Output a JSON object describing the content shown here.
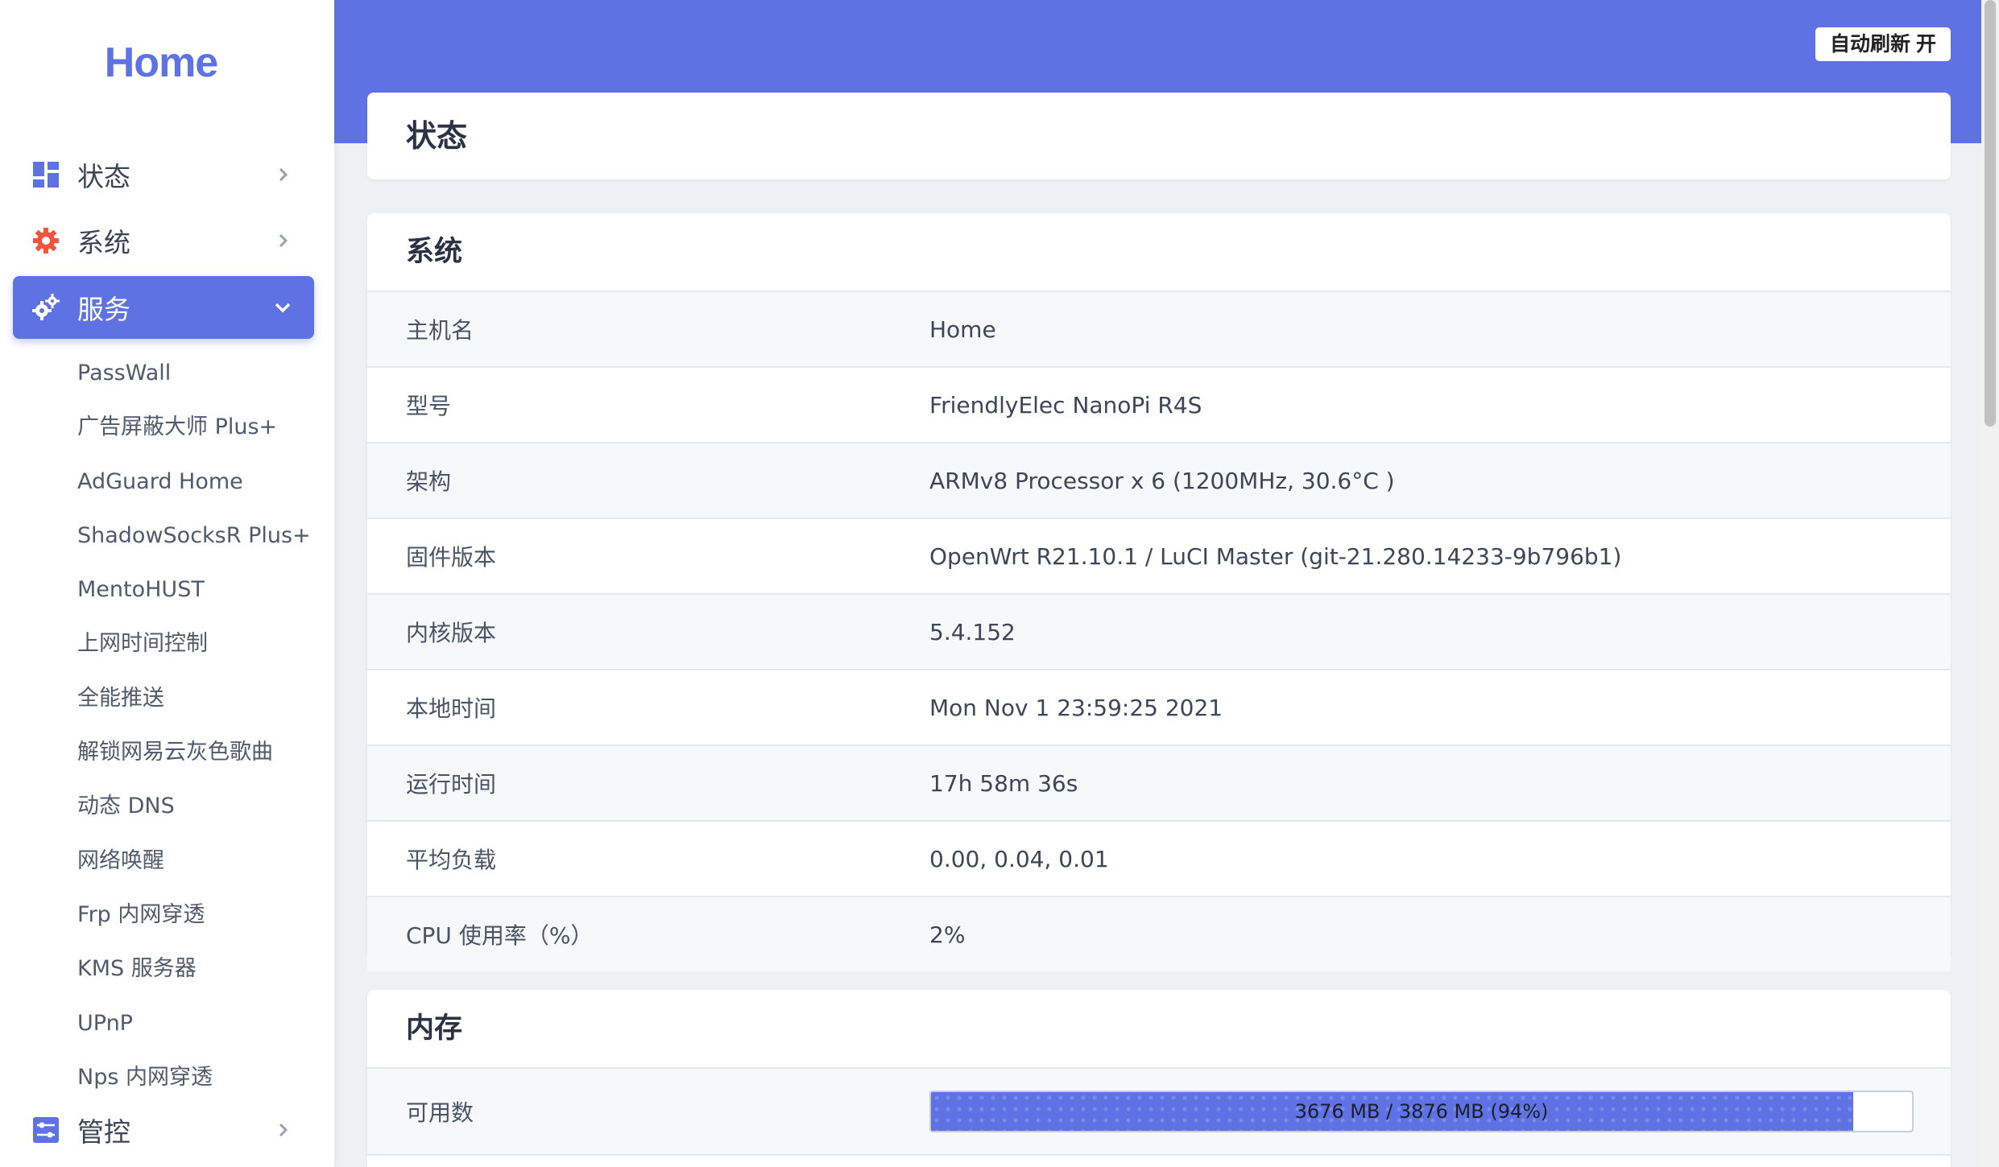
{
  "brand": "Home",
  "header": {
    "auto_refresh_label": "自动刷新 开"
  },
  "nav": {
    "status": {
      "label": "状态",
      "icon": "dashboard-icon",
      "color": "#5e72e4"
    },
    "system": {
      "label": "系统",
      "icon": "gear-icon",
      "color": "#f5533d"
    },
    "services": {
      "label": "服务",
      "icon": "cogs-icon",
      "color": "#ffffff"
    },
    "control": {
      "label": "管控",
      "icon": "sliders-icon",
      "color": "#5e72e4"
    }
  },
  "services_sub": [
    "PassWall",
    "广告屏蔽大师 Plus+",
    "AdGuard Home",
    "ShadowSocksR Plus+",
    "MentoHUST",
    "上网时间控制",
    "全能推送",
    "解锁网易云灰色歌曲",
    "动态 DNS",
    "网络唤醒",
    "Frp 内网穿透",
    "KMS 服务器",
    "UPnP",
    "Nps 内网穿透"
  ],
  "page": {
    "title": "状态"
  },
  "system": {
    "title": "系统",
    "rows": [
      {
        "key": "主机名",
        "value": "Home"
      },
      {
        "key": "型号",
        "value": "FriendlyElec NanoPi R4S"
      },
      {
        "key": "架构",
        "value": "ARMv8 Processor x 6 (1200MHz, 30.6°C )"
      },
      {
        "key": "固件版本",
        "value": "OpenWrt R21.10.1 / LuCI Master (git-21.280.14233-9b796b1)"
      },
      {
        "key": "内核版本",
        "value": "5.4.152"
      },
      {
        "key": "本地时间",
        "value": "Mon Nov 1 23:59:25 2021"
      },
      {
        "key": "运行时间",
        "value": "17h 58m 36s"
      },
      {
        "key": "平均负载",
        "value": "0.00, 0.04, 0.01"
      },
      {
        "key": "CPU 使用率（%）",
        "value": "2%"
      }
    ]
  },
  "memory": {
    "title": "内存",
    "available": {
      "key": "可用数",
      "text": "3676 MB / 3876 MB (94%)",
      "percent": 94
    }
  },
  "colors": {
    "accent": "#5e72e4",
    "danger": "#f5533d"
  }
}
